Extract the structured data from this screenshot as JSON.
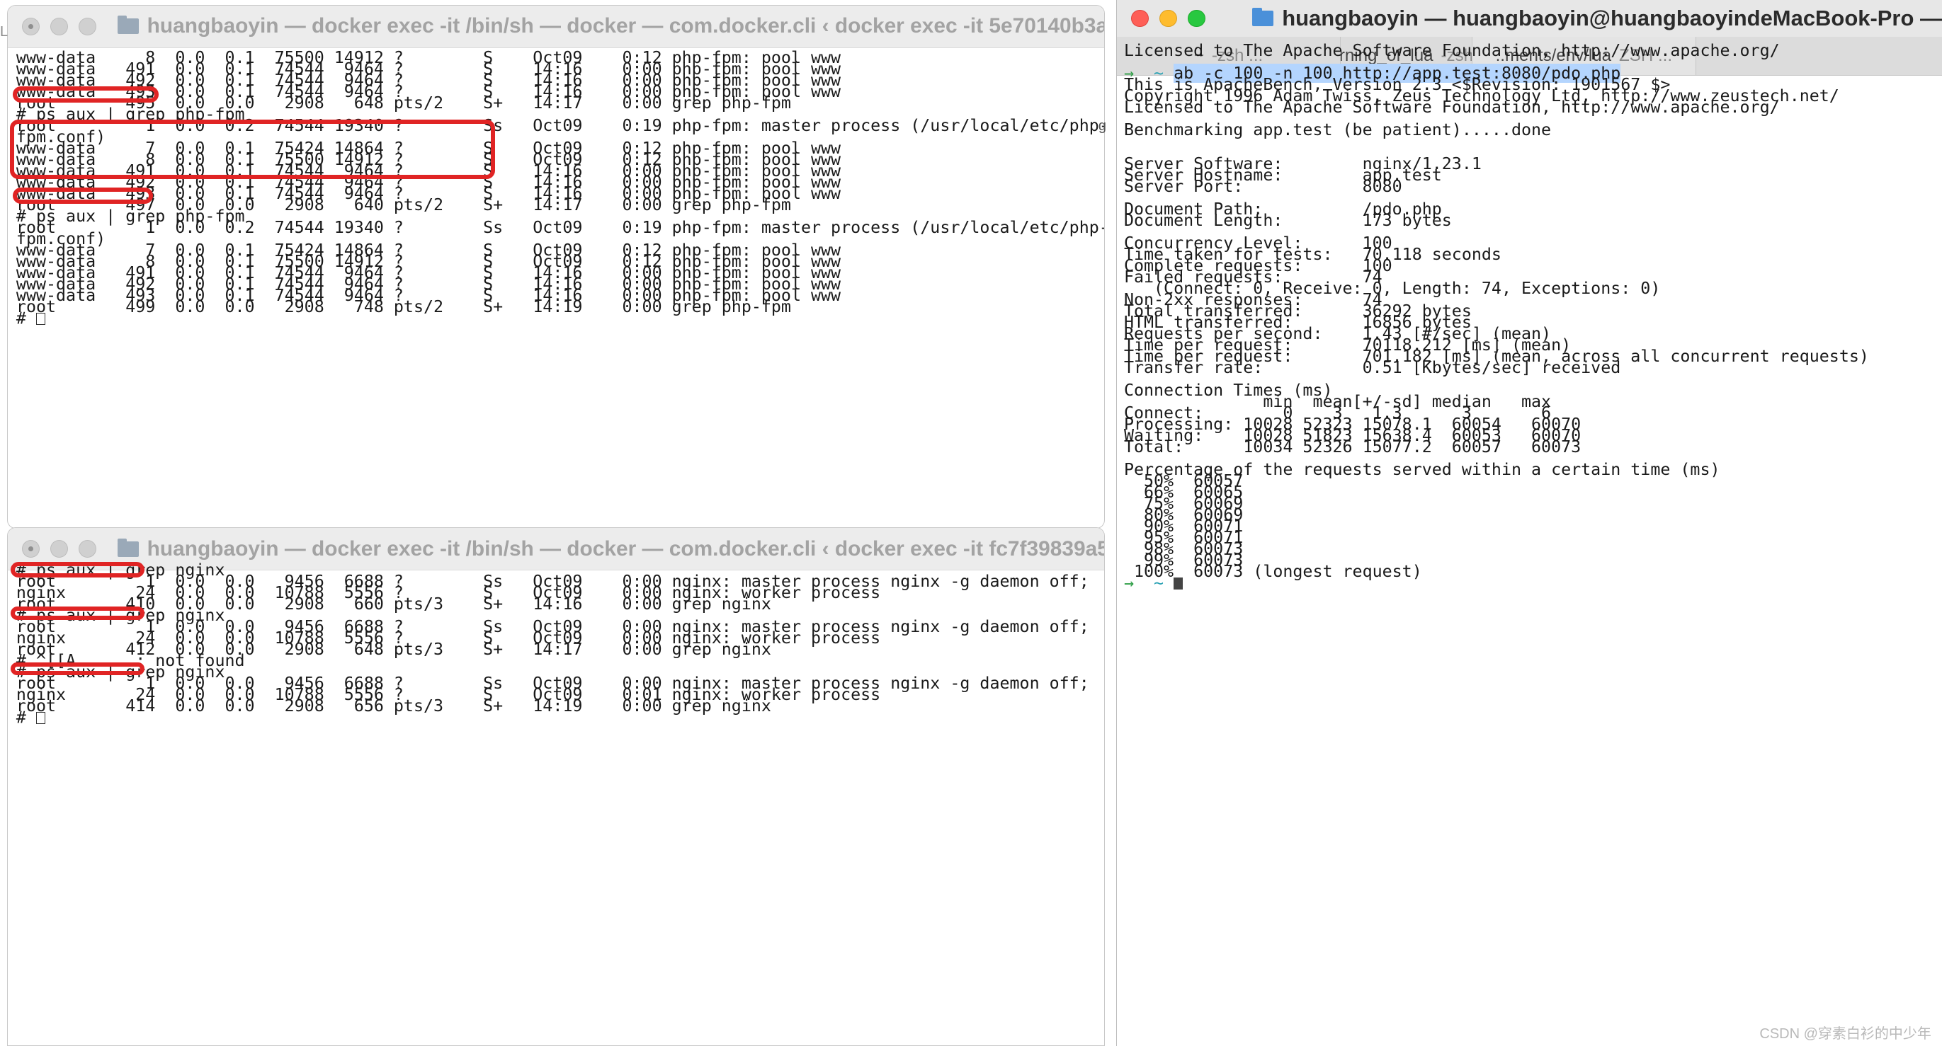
{
  "top_window": {
    "title": "huangbaoyin — docker exec -it /bin/sh — docker — com.docker.cli ‹ docker exec -it 5e70140b3a1455d0a1...",
    "lines": [
      "www-data     8  0.0  0.1  75500 14912 ?        S    Oct09    0:12 php-fpm: pool www",
      "www-data   491  0.0  0.1  74544  9464 ?        S    14:16    0:00 php-fpm: pool www",
      "www-data   492  0.0  0.1  74544  9464 ?        S    14:16    0:00 php-fpm: pool www",
      "www-data   493  0.0  0.1  74544  9464 ?        S    14:16    0:00 php-fpm: pool www",
      "root       495  0.0  0.0   2908   648 pts/2    S+   14:17    0:00 grep php-fpm",
      "# ps aux | grep php-fpm",
      "root         1  0.0  0.2  74544 19340 ?        Ss   Oct09    0:19 php-fpm: master process (/usr/local/etc/php-",
      "fpm.conf)",
      "www-data     7  0.0  0.1  75424 14864 ?        S    Oct09    0:12 php-fpm: pool www",
      "www-data     8  0.0  0.1  75500 14912 ?        S    Oct09    0:12 php-fpm: pool www",
      "www-data   491  0.0  0.1  74544  9464 ?        S    14:16    0:00 php-fpm: pool www",
      "www-data   492  0.0  0.1  74544  9464 ?        S    14:16    0:00 php-fpm: pool www",
      "www-data   493  0.0  0.1  74544  9464 ?        S    14:16    0:00 php-fpm: pool www",
      "root       497  0.0  0.0   2908   640 pts/2    S+   14:17    0:00 grep php-fpm",
      "# ps aux | grep php-fpm",
      "root         1  0.0  0.2  74544 19340 ?        Ss   Oct09    0:19 php-fpm: master process (/usr/local/etc/php-",
      "fpm.conf)",
      "www-data     7  0.0  0.1  75424 14864 ?        S    Oct09    0:12 php-fpm: pool www",
      "www-data     8  0.0  0.1  75500 14912 ?        S    Oct09    0:12 php-fpm: pool www",
      "www-data   491  0.0  0.1  74544  9464 ?        S    14:16    0:00 php-fpm: pool www",
      "www-data   492  0.0  0.1  74544  9464 ?        S    14:16    0:00 php-fpm: pool www",
      "www-data   493  0.0  0.1  74544  9464 ?        S    14:16    0:00 php-fpm: pool www",
      "root       499  0.0  0.0   2908   748 pts/2    S+   14:19    0:00 grep php-fpm",
      "# "
    ]
  },
  "bottom_window": {
    "title": "huangbaoyin — docker exec -it /bin/sh — docker — com.docker.cli ‹ docker exec -it fc7f39839a58627fdcd...",
    "lines": [
      "# ps aux | grep nginx",
      "root         1  0.0  0.0   9456  6688 ?        Ss   Oct09    0:00 nginx: master process nginx -g daemon off;",
      "nginx       24  0.0  0.0  10788  5556 ?        S    Oct09    0:00 nginx: worker process",
      "root       410  0.0  0.0   2908   660 pts/3    S+   14:16    0:00 grep nginx",
      "# ps aux | grep nginx",
      "root         1  0.0  0.0   9456  6688 ?        Ss   Oct09    0:00 nginx: master process nginx -g daemon off;",
      "nginx       24  0.0  0.0  10788  5556 ?        S    Oct09    0:00 nginx: worker process",
      "root       412  0.0  0.0   2908   648 pts/3    S+   14:17    0:00 grep nginx",
      "# ^[[A      : not found",
      "# ps aux | grep nginx",
      "root         1  0.0  0.0   9456  6688 ?        Ss   Oct09    0:00 nginx: master process nginx -g daemon off;",
      "nginx       24  0.0  0.0  10788  5556 ?        S    Oct09    0:01 nginx: worker process",
      "root       414  0.0  0.0   2908   656 pts/3    S+   14:19    0:00 grep nginx",
      "# "
    ]
  },
  "right_window": {
    "title": "huangbaoyin — huangbaoyin@huangbaoyindeMacBook-Pro —",
    "tabs": [
      {
        "label": "~",
        "sub": "-zsh ..."
      },
      {
        "label": "..arning_of_lua",
        "sub": "-zsh ..."
      },
      {
        "label": "..ments/env/lua",
        "sub": "ZSH ..."
      }
    ],
    "prompt_arrow": "→",
    "prompt_tilde": "~",
    "command": "ab -c 100 -n 100 http://app.test:8080/pdo.php",
    "lines_before": [
      "Licensed to The Apache Software Foundation, http://www.apache.org/",
      ""
    ],
    "lines_after": [
      "This is ApacheBench, Version 2.3 <$Revision: 1901567 $>",
      "Copyright 1996 Adam Twiss, Zeus Technology Ltd, http://www.zeustech.net/",
      "Licensed to The Apache Software Foundation, http://www.apache.org/",
      "",
      "Benchmarking app.test (be patient).....done",
      "",
      "",
      "Server Software:        nginx/1.23.1",
      "Server Hostname:        app.test",
      "Server Port:            8080",
      "",
      "Document Path:          /pdo.php",
      "Document Length:        173 bytes",
      "",
      "Concurrency Level:      100",
      "Time taken for tests:   70.118 seconds",
      "Complete requests:      100",
      "Failed requests:        74",
      "   (Connect: 0, Receive: 0, Length: 74, Exceptions: 0)",
      "Non-2xx responses:      74",
      "Total transferred:      36292 bytes",
      "HTML transferred:       16856 bytes",
      "Requests per second:    1.43 [#/sec] (mean)",
      "Time per request:       70118.212 [ms] (mean)",
      "Time per request:       701.182 [ms] (mean, across all concurrent requests)",
      "Transfer rate:          0.51 [Kbytes/sec] received",
      "",
      "Connection Times (ms)",
      "              min  mean[+/-sd] median   max",
      "Connect:        0    3   1.3      3       6",
      "Processing: 10028 52323 15078.1  60054   60070",
      "Waiting:    10028 51823 15638.4  60053   60070",
      "Total:      10034 52326 15077.2  60057   60073",
      "",
      "Percentage of the requests served within a certain time (ms)",
      "  50%  60057",
      "  66%  60065",
      "  75%  60069",
      "  80%  60069",
      "  90%  60071",
      "  95%  60071",
      "  98%  60073",
      "  99%  60073",
      " 100%  60073 (longest request)"
    ]
  },
  "watermark": "CSDN @穿素白衫的中少年",
  "colors": {
    "highlight": "#e02424",
    "selection": "#b4d5fe",
    "prompt_green": "#2e9e46",
    "prompt_cyan": "#2aa1b3"
  }
}
